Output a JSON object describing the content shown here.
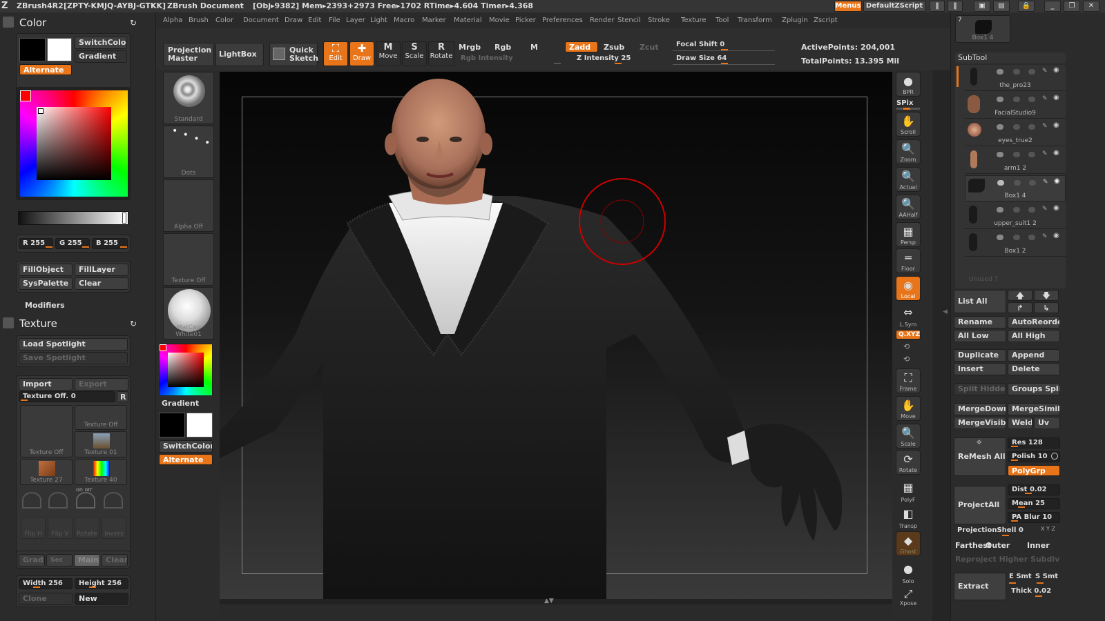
{
  "titlebar": {
    "app": "ZBrush4R2",
    "serial": "[ZPTY-KMJQ-AYBJ-GTKK]",
    "doc": "ZBrush Document",
    "stats": "[Obj▸9382] Mem▸2393+2973 Free▸1702 RTime▸4.604 Timer▸4.368",
    "menus_btn": "Menus",
    "script_btn": "DefaultZScript"
  },
  "menubar": [
    "Alpha",
    "Brush",
    "Color",
    "Document",
    "Draw",
    "Edit",
    "File",
    "Layer",
    "Light",
    "Macro",
    "Marker",
    "Material",
    "Movie",
    "Picker",
    "Preferences",
    "Render",
    "Stencil",
    "Stroke",
    "Texture",
    "Tool",
    "Transform",
    "Zplugin",
    "Zscript"
  ],
  "color_panel": {
    "title": "Color",
    "switch_color": "SwitchColor",
    "gradient": "Gradient",
    "alternate": "Alternate",
    "r": "R 255",
    "g": "G 255",
    "b": "B 255",
    "fill_object": "FillObject",
    "fill_layer": "FillLayer",
    "sys_palette": "SysPalette",
    "clear": "Clear",
    "modifiers": "Modifiers"
  },
  "texture_panel": {
    "title": "Texture",
    "load_spotlight": "Load Spotlight",
    "save_spotlight": "Save Spotlight",
    "import": "Import",
    "export": "Export",
    "texture_off_slider": "Texture Off. 0",
    "r_btn": "R",
    "thumbs": [
      "Texture Off",
      "Texture Off",
      "Texture 01",
      "Texture 27",
      "Texture 40"
    ],
    "on_off": "on  orr",
    "flip_h": "Flip H",
    "flip_v": "Flip V",
    "rotate": "Rotate",
    "invers": "Invers",
    "grad": "Grad",
    "sec": "Sec",
    "main": "Main",
    "clear2": "Clear",
    "width": "Width 256",
    "height": "Height 256",
    "clone": "Clone",
    "new": "New"
  },
  "shelf": {
    "projection_master": "Projection Master",
    "lightbox": "LightBox",
    "quick_sketch": "Quick Sketch",
    "edit": "Edit",
    "draw": "Draw",
    "move": "Move",
    "scale": "Scale",
    "rotate": "Rotate",
    "mrgb": "Mrgb",
    "rgb": "Rgb",
    "m": "M",
    "zadd": "Zadd",
    "zsub": "Zsub",
    "zcut": "Zcut",
    "rgb_intensity": "Rgb Intensity",
    "z_intensity": "Z Intensity 25",
    "focal_shift": "Focal Shift 0",
    "draw_size": "Draw Size 64",
    "active_points": "ActivePoints: 204,001",
    "total_points": "TotalPoints: 13.395 Mil"
  },
  "brush_col": {
    "standard": "Standard",
    "dots": "Dots",
    "alpha_off": "Alpha Off",
    "texture_off": "Texture Off",
    "matcap": "MatCap White01",
    "gradient": "Gradient",
    "switch_color": "SwitchColor",
    "alternate": "Alternate"
  },
  "right_bar": [
    {
      "label": "BPR",
      "icon": "●"
    },
    {
      "label": "Scroll",
      "icon": "✋"
    },
    {
      "label": "Zoom",
      "icon": "🔍"
    },
    {
      "label": "Actual",
      "icon": "🔍"
    },
    {
      "label": "AAHalf",
      "icon": "🔍"
    },
    {
      "label": "Persp",
      "icon": "▦"
    },
    {
      "label": "Floor",
      "icon": "═"
    },
    {
      "label": "Local",
      "icon": "◉"
    },
    {
      "label": "L.Sym",
      "icon": "⇔"
    },
    {
      "label": "Frame",
      "icon": "⛶"
    },
    {
      "label": "Move",
      "icon": "✋"
    },
    {
      "label": "Scale",
      "icon": "🔍"
    },
    {
      "label": "Rotate",
      "icon": "⟳"
    },
    {
      "label": "PolyF",
      "icon": "▦"
    },
    {
      "label": "Transp",
      "icon": "◧"
    },
    {
      "label": "Ghost",
      "icon": "◆"
    },
    {
      "label": "Solo",
      "icon": "●"
    },
    {
      "label": "Xpose",
      "icon": "⤢"
    }
  ],
  "right_extra": {
    "spix": "SPix",
    "xyz": "Q.XYZ"
  },
  "subtool": {
    "tool_count": "7",
    "tool_name": "Box1 4",
    "title": "SubTool",
    "items": [
      "the_pro23",
      "FacialStudio9",
      "eyes_true2",
      "arm1 2",
      "Box1 4",
      "upper_suit1 2",
      "Box1 2"
    ],
    "unused": "Unused 7",
    "list_all": "List All",
    "rename": "Rename",
    "auto_reorder": "AutoReorder",
    "all_low": "All Low",
    "all_high": "All High",
    "duplicate": "Duplicate",
    "append": "Append",
    "insert": "Insert",
    "delete": "Delete",
    "split_hidden": "Split Hidden",
    "groups_split": "Groups Split",
    "merge_down": "MergeDown",
    "merge_similar": "MergeSimilar",
    "merge_visible": "MergeVisible",
    "weld": "Weld",
    "uv": "Uv",
    "remesh_all": "ReMesh All",
    "res": "Res 128",
    "polish": "Polish 10",
    "polygrp": "PolyGrp",
    "project_all": "ProjectAll",
    "dist": "Dist 0.02",
    "mean": "Mean 25",
    "pa_blur": "PA Blur 10",
    "projection_shell": "ProjectionShell 0",
    "xyz_small": "X Y Z",
    "farthest": "Farthest",
    "outer": "Outer",
    "inner": "Inner",
    "reproject": "Reproject Higher Subdiv",
    "extract": "Extract",
    "e_smt": "E Smt",
    "s_smt": "S Smt",
    "thick": "Thick 0.02"
  },
  "colors": {
    "accent": "#e8751a"
  }
}
